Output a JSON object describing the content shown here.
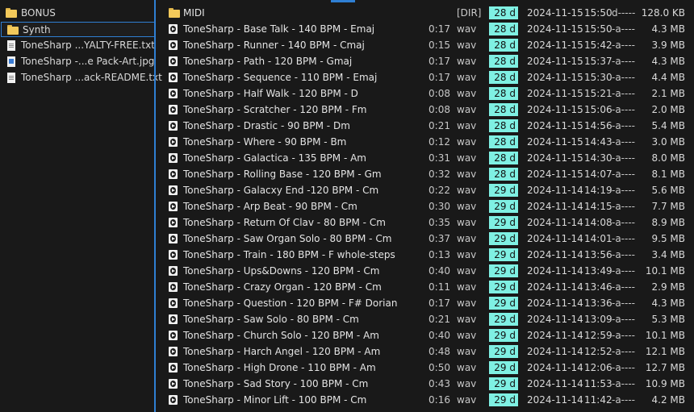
{
  "tree": [
    {
      "kind": "folder",
      "label": "BONUS",
      "selected": false,
      "icon": "folder-icon"
    },
    {
      "kind": "folder",
      "label": "Synth",
      "selected": true,
      "icon": "folder-icon"
    },
    {
      "kind": "txt",
      "label": "ToneSharp ...YALTY-FREE.txt",
      "selected": false,
      "icon": "text-file-icon"
    },
    {
      "kind": "img",
      "label": "ToneSharp -...e Pack-Art.jpg",
      "selected": false,
      "icon": "image-file-icon"
    },
    {
      "kind": "txt",
      "label": "ToneSharp ...ack-README.txt",
      "selected": false,
      "icon": "text-file-icon"
    }
  ],
  "files": [
    {
      "folder": true,
      "name": "MIDI",
      "duration": "",
      "type": "[DIR]",
      "age": "28 d",
      "date": "2024-11-15",
      "time": "15:50",
      "attrs": "d-----",
      "size": "128.0 KB"
    },
    {
      "name": "ToneSharp - Base Talk - 140 BPM - Emaj",
      "duration": "0:17",
      "type": "wav",
      "age": "28 d",
      "date": "2024-11-15",
      "time": "15:50",
      "attrs": "-a----",
      "size": "4.3 MB"
    },
    {
      "name": "ToneSharp - Runner - 140 BPM - Cmaj",
      "duration": "0:15",
      "type": "wav",
      "age": "28 d",
      "date": "2024-11-15",
      "time": "15:42",
      "attrs": "-a----",
      "size": "3.9 MB"
    },
    {
      "name": "ToneSharp - Path - 120 BPM - Gmaj",
      "duration": "0:17",
      "type": "wav",
      "age": "28 d",
      "date": "2024-11-15",
      "time": "15:37",
      "attrs": "-a----",
      "size": "4.3 MB"
    },
    {
      "name": "ToneSharp - Sequence - 110 BPM - Emaj",
      "duration": "0:17",
      "type": "wav",
      "age": "28 d",
      "date": "2024-11-15",
      "time": "15:30",
      "attrs": "-a----",
      "size": "4.4 MB"
    },
    {
      "name": "ToneSharp - Half Walk - 120 BPM - D",
      "duration": "0:08",
      "type": "wav",
      "age": "28 d",
      "date": "2024-11-15",
      "time": "15:21",
      "attrs": "-a----",
      "size": "2.1 MB"
    },
    {
      "name": "ToneSharp - Scratcher - 120 BPM - Fm",
      "duration": "0:08",
      "type": "wav",
      "age": "28 d",
      "date": "2024-11-15",
      "time": "15:06",
      "attrs": "-a----",
      "size": "2.0 MB"
    },
    {
      "name": "ToneSharp - Drastic - 90 BPM - Dm",
      "duration": "0:21",
      "type": "wav",
      "age": "28 d",
      "date": "2024-11-15",
      "time": "14:56",
      "attrs": "-a----",
      "size": "5.4 MB"
    },
    {
      "name": "ToneSharp - Where - 90 BPM - Bm",
      "duration": "0:12",
      "type": "wav",
      "age": "28 d",
      "date": "2024-11-15",
      "time": "14:43",
      "attrs": "-a----",
      "size": "3.0 MB"
    },
    {
      "name": "ToneSharp - Galactica - 135 BPM - Am",
      "duration": "0:31",
      "type": "wav",
      "age": "28 d",
      "date": "2024-11-15",
      "time": "14:30",
      "attrs": "-a----",
      "size": "8.0 MB"
    },
    {
      "name": "ToneSharp - Rolling Base - 120 BPM - Gm",
      "duration": "0:32",
      "type": "wav",
      "age": "28 d",
      "date": "2024-11-15",
      "time": "14:07",
      "attrs": "-a----",
      "size": "8.1 MB"
    },
    {
      "name": "ToneSharp - Galacxy End -120 BPM - Cm",
      "duration": "0:22",
      "type": "wav",
      "age": "29 d",
      "date": "2024-11-14",
      "time": "14:19",
      "attrs": "-a----",
      "size": "5.6 MB"
    },
    {
      "name": "ToneSharp - Arp Beat - 90 BPM - Cm",
      "duration": "0:30",
      "type": "wav",
      "age": "29 d",
      "date": "2024-11-14",
      "time": "14:15",
      "attrs": "-a----",
      "size": "7.7 MB"
    },
    {
      "name": "ToneSharp - Return Of Clav - 80 BPM - Cm",
      "duration": "0:35",
      "type": "wav",
      "age": "29 d",
      "date": "2024-11-14",
      "time": "14:08",
      "attrs": "-a----",
      "size": "8.9 MB"
    },
    {
      "name": "ToneSharp - Saw Organ Solo - 80 BPM - Cm",
      "duration": "0:37",
      "type": "wav",
      "age": "29 d",
      "date": "2024-11-14",
      "time": "14:01",
      "attrs": "-a----",
      "size": "9.5 MB"
    },
    {
      "name": "ToneSharp - Train - 180 BPM - F whole-steps",
      "duration": "0:13",
      "type": "wav",
      "age": "29 d",
      "date": "2024-11-14",
      "time": "13:56",
      "attrs": "-a----",
      "size": "3.4 MB"
    },
    {
      "name": "ToneSharp - Ups&Downs - 120 BPM - Cm",
      "duration": "0:40",
      "type": "wav",
      "age": "29 d",
      "date": "2024-11-14",
      "time": "13:49",
      "attrs": "-a----",
      "size": "10.1 MB"
    },
    {
      "name": "ToneSharp - Crazy Organ - 120 BPM - Cm",
      "duration": "0:11",
      "type": "wav",
      "age": "29 d",
      "date": "2024-11-14",
      "time": "13:46",
      "attrs": "-a----",
      "size": "2.9 MB"
    },
    {
      "name": "ToneSharp - Question - 120 BPM - F# Dorian",
      "duration": "0:17",
      "type": "wav",
      "age": "29 d",
      "date": "2024-11-14",
      "time": "13:36",
      "attrs": "-a----",
      "size": "4.3 MB"
    },
    {
      "name": "ToneSharp - Saw Solo - 80 BPM - Cm",
      "duration": "0:21",
      "type": "wav",
      "age": "29 d",
      "date": "2024-11-14",
      "time": "13:09",
      "attrs": "-a----",
      "size": "5.3 MB"
    },
    {
      "name": "ToneSharp - Church Solo - 120 BPM - Am",
      "duration": "0:40",
      "type": "wav",
      "age": "29 d",
      "date": "2024-11-14",
      "time": "12:59",
      "attrs": "-a----",
      "size": "10.1 MB"
    },
    {
      "name": "ToneSharp - Harch Angel - 120 BPM - Am",
      "duration": "0:48",
      "type": "wav",
      "age": "29 d",
      "date": "2024-11-14",
      "time": "12:52",
      "attrs": "-a----",
      "size": "12.1 MB"
    },
    {
      "name": "ToneSharp - High Drone - 110 BPM - Am",
      "duration": "0:50",
      "type": "wav",
      "age": "29 d",
      "date": "2024-11-14",
      "time": "12:06",
      "attrs": "-a----",
      "size": "12.7 MB"
    },
    {
      "name": "ToneSharp - Sad Story - 100 BPM - Cm",
      "duration": "0:43",
      "type": "wav",
      "age": "29 d",
      "date": "2024-11-14",
      "time": "11:53",
      "attrs": "-a----",
      "size": "10.9 MB"
    },
    {
      "name": "ToneSharp - Minor Lift - 100 BPM - Cm",
      "duration": "0:16",
      "type": "wav",
      "age": "29 d",
      "date": "2024-11-14",
      "time": "11:42",
      "attrs": "-a----",
      "size": "4.2 MB"
    }
  ],
  "colors": {
    "accent": "#2f7fd3",
    "age_badge": "#7ff0e3",
    "background": "#191919"
  }
}
